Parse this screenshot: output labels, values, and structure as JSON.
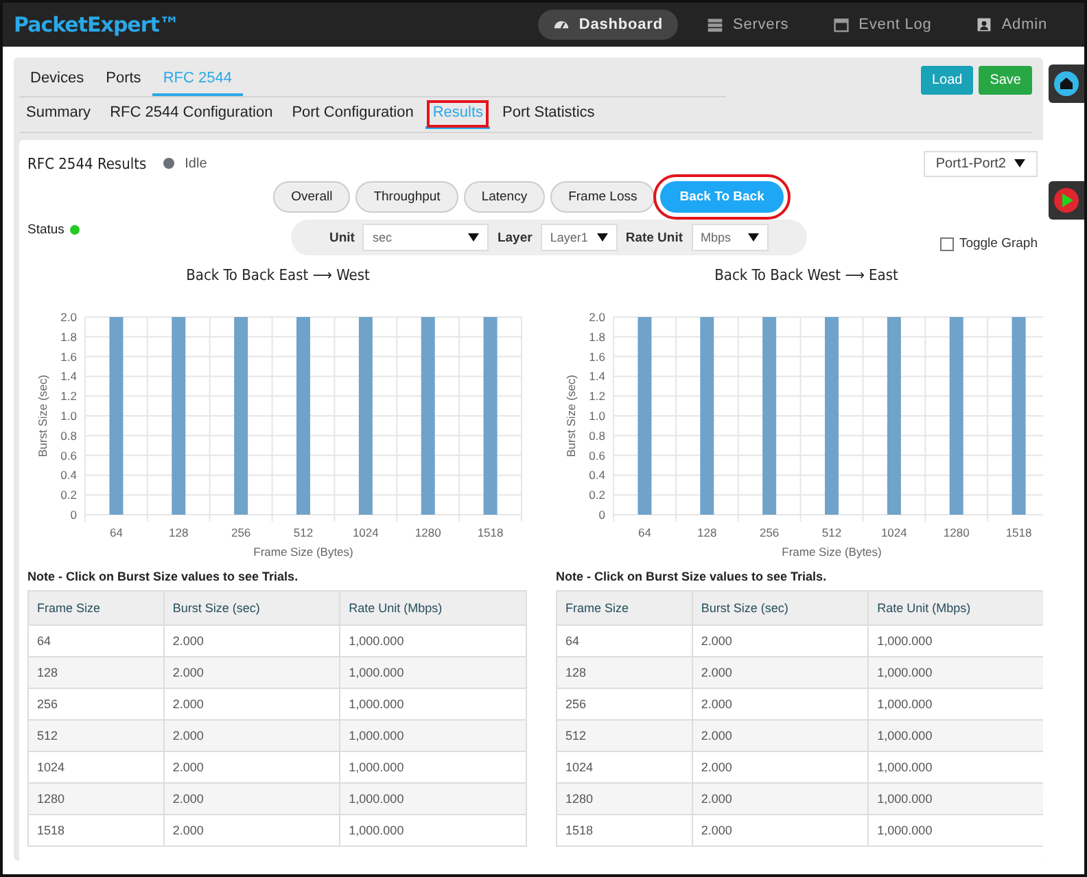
{
  "app": {
    "title": "PacketExpert™"
  },
  "nav": [
    {
      "label": "Dashboard",
      "selected": true
    },
    {
      "label": "Servers",
      "selected": false
    },
    {
      "label": "Event Log",
      "selected": false
    },
    {
      "label": "Admin",
      "selected": false
    }
  ],
  "tabs": [
    {
      "label": "Devices",
      "selected": false
    },
    {
      "label": "Ports",
      "selected": false
    },
    {
      "label": "RFC 2544",
      "selected": true
    }
  ],
  "actions": [
    {
      "label": "Load",
      "kind": "info"
    },
    {
      "label": "Save",
      "kind": "success"
    }
  ],
  "subtabs": [
    {
      "label": "Summary",
      "selected": false,
      "highlighted": false
    },
    {
      "label": "RFC 2544 Configuration",
      "selected": false,
      "highlighted": false
    },
    {
      "label": "Port Configuration",
      "selected": false,
      "highlighted": false
    },
    {
      "label": "Results",
      "selected": true,
      "highlighted": true
    },
    {
      "label": "Port Statistics",
      "selected": false,
      "highlighted": false
    }
  ],
  "results": {
    "title": "RFC 2544 Results",
    "state": "Idle",
    "port_select": "Port1-Port2",
    "views": [
      {
        "label": "Overall",
        "selected": false,
        "highlighted": false
      },
      {
        "label": "Throughput",
        "selected": false,
        "highlighted": false
      },
      {
        "label": "Latency",
        "selected": false,
        "highlighted": false
      },
      {
        "label": "Frame Loss",
        "selected": false,
        "highlighted": false
      },
      {
        "label": "Back To Back",
        "selected": true,
        "highlighted": true
      }
    ],
    "status": {
      "label": "Status",
      "color": "#22cc22"
    },
    "filters": [
      {
        "label": "Unit",
        "value": "sec",
        "wide": true
      },
      {
        "label": "Layer",
        "value": "Layer1",
        "wide": false
      },
      {
        "label": "Rate Unit",
        "value": "Mbps",
        "wide": false
      }
    ],
    "toggle_graph": {
      "label": "Toggle Graph",
      "checked": false
    },
    "panels": [
      {
        "chart_data": {
          "type": "bar",
          "grid": true,
          "title": "Back To Back East ⟶ West",
          "xlabel": "Frame Size (Bytes)",
          "ylabel": "Burst Size (sec)",
          "categories": [
            "64",
            "128",
            "256",
            "512",
            "1024",
            "1280",
            "1518"
          ],
          "series": [
            {
              "color": "#6fa3c9",
              "values": [
                2,
                2,
                2,
                2,
                2,
                2,
                2
              ]
            }
          ],
          "ylim": [
            0,
            2
          ],
          "yticks": [
            0,
            {
              "value": 0.2,
              "label": "0.2"
            },
            {
              "value": 0.4,
              "label": "0.4"
            },
            {
              "value": 0.6,
              "label": "0.6"
            },
            {
              "value": 0.8,
              "label": "0.8"
            },
            {
              "value": 1,
              "label": "1.0"
            },
            {
              "value": 1.2,
              "label": "1.2"
            },
            {
              "value": 1.4,
              "label": "1.4"
            },
            {
              "value": 1.6,
              "label": "1.6"
            },
            {
              "value": 1.8,
              "label": "1.8"
            },
            {
              "value": 2,
              "label": "2.0"
            }
          ]
        },
        "note": "Note - Click on Burst Size values to see Trials.",
        "columns": [
          "Frame Size",
          "Burst Size (sec)",
          "Rate Unit (Mbps)"
        ],
        "rows": [
          [
            "64",
            "2.000",
            "1,000.000"
          ],
          [
            "128",
            "2.000",
            "1,000.000"
          ],
          [
            "256",
            "2.000",
            "1,000.000"
          ],
          [
            "512",
            "2.000",
            "1,000.000"
          ],
          [
            "1024",
            "2.000",
            "1,000.000"
          ],
          [
            "1280",
            "2.000",
            "1,000.000"
          ],
          [
            "1518",
            "2.000",
            "1,000.000"
          ]
        ]
      },
      {
        "chart_data": {
          "type": "bar",
          "grid": true,
          "title": "Back To Back West ⟶ East",
          "xlabel": "Frame Size (Bytes)",
          "ylabel": "Burst Size (sec)",
          "categories": [
            "64",
            "128",
            "256",
            "512",
            "1024",
            "1280",
            "1518"
          ],
          "series": [
            {
              "color": "#6fa3c9",
              "values": [
                2,
                2,
                2,
                2,
                2,
                2,
                2
              ]
            }
          ],
          "ylim": [
            0,
            2
          ],
          "yticks": [
            0,
            {
              "value": 0.2,
              "label": "0.2"
            },
            {
              "value": 0.4,
              "label": "0.4"
            },
            {
              "value": 0.6,
              "label": "0.6"
            },
            {
              "value": 0.8,
              "label": "0.8"
            },
            {
              "value": 1,
              "label": "1.0"
            },
            {
              "value": 1.2,
              "label": "1.2"
            },
            {
              "value": 1.4,
              "label": "1.4"
            },
            {
              "value": 1.6,
              "label": "1.6"
            },
            {
              "value": 1.8,
              "label": "1.8"
            },
            {
              "value": 2,
              "label": "2.0"
            }
          ]
        },
        "note": "Note - Click on Burst Size values to see Trials.",
        "columns": [
          "Frame Size",
          "Burst Size (sec)",
          "Rate Unit (Mbps)"
        ],
        "rows": [
          [
            "64",
            "2.000",
            "1,000.000"
          ],
          [
            "128",
            "2.000",
            "1,000.000"
          ],
          [
            "256",
            "2.000",
            "1,000.000"
          ],
          [
            "512",
            "2.000",
            "1,000.000"
          ],
          [
            "1024",
            "2.000",
            "1,000.000"
          ],
          [
            "1280",
            "2.000",
            "1,000.000"
          ],
          [
            "1518",
            "2.000",
            "1,000.000"
          ]
        ]
      }
    ]
  }
}
